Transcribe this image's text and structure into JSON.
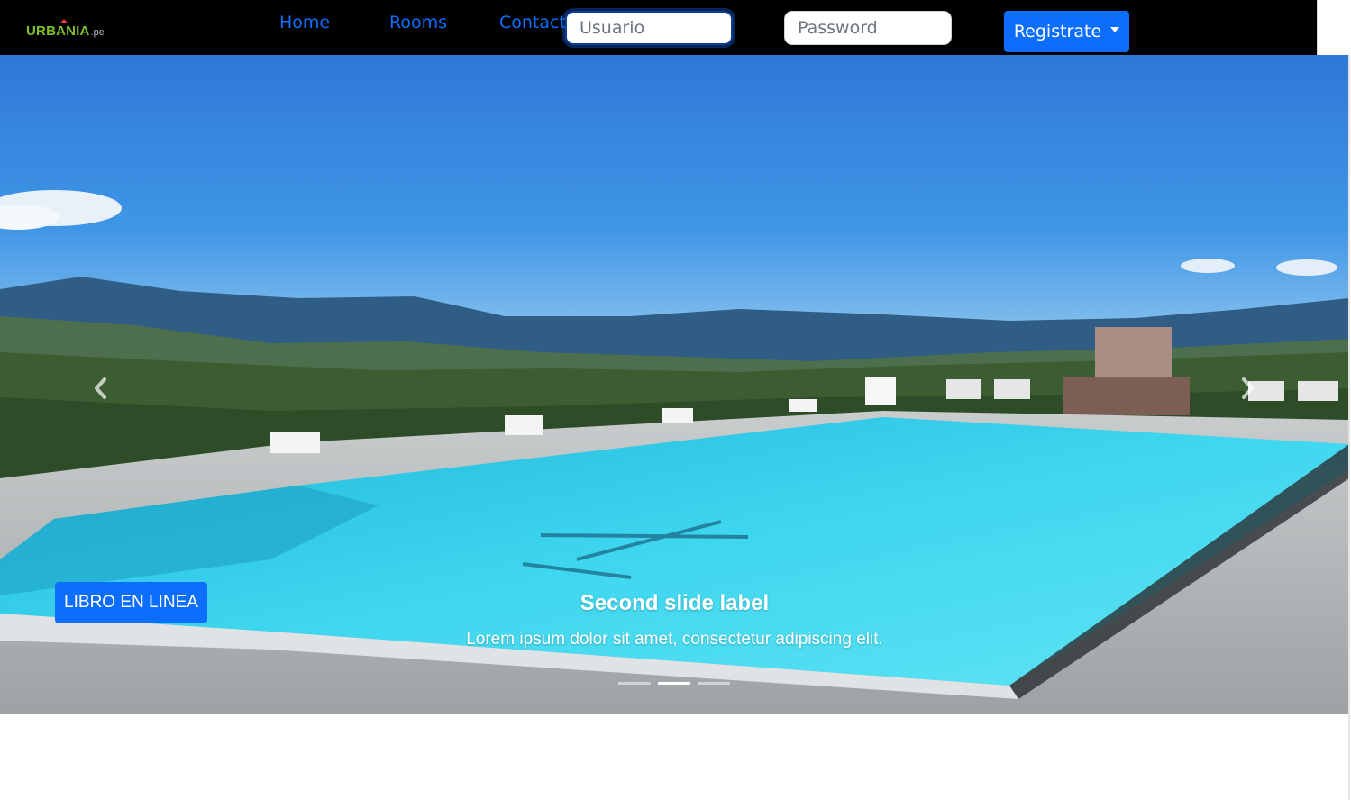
{
  "brand": {
    "name": "URBANIA",
    "suffix": ".pe",
    "color": "#7fbf2a",
    "accent": "#e33b2e"
  },
  "nav": {
    "links": [
      {
        "label": "Home"
      },
      {
        "label": "Rooms"
      },
      {
        "label": "Contact"
      }
    ],
    "link_color": "#0d6efd"
  },
  "login": {
    "user_placeholder": "Usuario",
    "password_placeholder": "Password",
    "register_label": "Registrate"
  },
  "carousel": {
    "book_button": "LIBRO EN LINEA",
    "caption_title": "Second slide label",
    "caption_text": "Lorem ipsum dolor sit amet, consectetur adipiscing elit.",
    "slide_count": 3,
    "active_index": 1,
    "prev_icon": "chevron-left-icon",
    "next_icon": "chevron-right-icon"
  },
  "colors": {
    "primary": "#0d6efd",
    "navbar": "#000000",
    "sky": "#2a86dc",
    "water": "#3fd2ee"
  }
}
